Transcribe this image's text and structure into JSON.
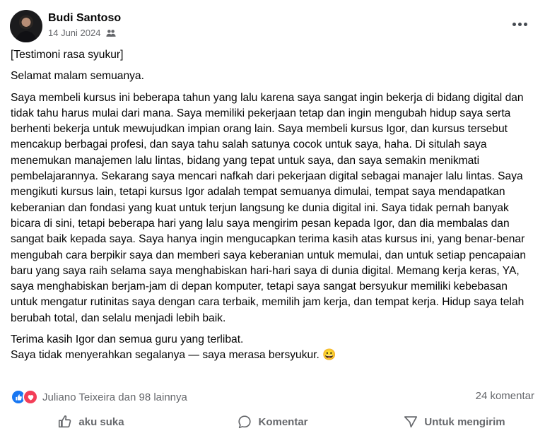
{
  "post": {
    "author": "Budi Santoso",
    "date": "14 Juni 2024",
    "privacy_icon": "friends-icon",
    "more_icon": "more-dots-icon",
    "paragraphs": {
      "title": "[Testimoni rasa syukur]",
      "greeting": "Selamat malam semuanya.",
      "body": "Saya membeli kursus ini beberapa tahun yang lalu karena saya sangat ingin bekerja di bidang digital dan tidak tahu harus mulai dari mana. Saya memiliki pekerjaan tetap dan ingin mengubah hidup saya serta berhenti bekerja untuk mewujudkan impian orang lain. Saya membeli kursus Igor, dan kursus tersebut mencakup berbagai profesi, dan saya tahu salah satunya cocok untuk saya, haha. Di situlah saya menemukan manajemen lalu lintas, bidang yang tepat untuk saya, dan saya semakin menikmati pembelajarannya. Sekarang saya mencari nafkah dari pekerjaan digital sebagai manajer lalu lintas. Saya mengikuti kursus lain, tetapi kursus Igor adalah tempat semuanya dimulai, tempat saya mendapatkan keberanian dan fondasi yang kuat untuk terjun langsung ke dunia digital ini. Saya tidak pernah banyak bicara di sini, tetapi beberapa hari yang lalu saya mengirim pesan kepada Igor, dan dia membalas dan sangat baik kepada saya. Saya hanya ingin mengucapkan terima kasih atas kursus ini, yang benar-benar mengubah cara berpikir saya dan memberi saya keberanian untuk memulai, dan untuk setiap pencapaian baru yang saya raih selama saya menghabiskan hari-hari saya di dunia digital. Memang kerja keras, YA, saya menghabiskan berjam-jam di depan komputer, tetapi saya sangat bersyukur memiliki kebebasan untuk mengatur rutinitas saya dengan cara terbaik, memilih jam kerja, dan tempat kerja. Hidup saya telah berubah total, dan selalu menjadi lebih baik.",
      "thanks": "Terima kasih Igor dan semua guru yang terlibat.",
      "closing": "Saya tidak menyerahkan segalanya — saya merasa bersyukur. 😀"
    }
  },
  "reactions": {
    "icons": [
      "like-icon",
      "love-icon"
    ],
    "text": "Juliano Teixeira dan 98 lainnya",
    "comments": "24 komentar"
  },
  "actions": {
    "like": "aku suka",
    "comment": "Komentar",
    "share": "Untuk mengirim"
  },
  "colors": {
    "text": "#050505",
    "secondary": "#65676b",
    "like_blue": "#1877f2",
    "love_red": "#f33e58"
  }
}
